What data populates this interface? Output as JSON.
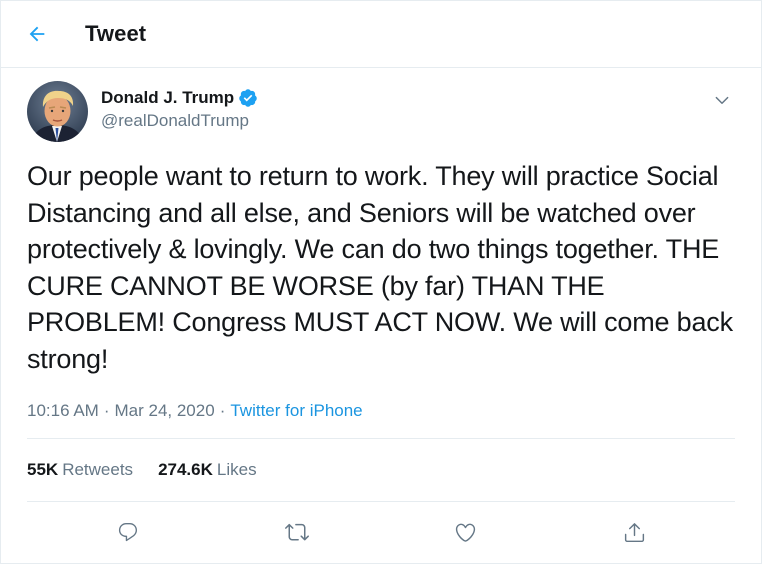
{
  "header": {
    "title": "Tweet",
    "back_icon": "arrow-left-icon"
  },
  "author": {
    "name": "Donald J. Trump",
    "handle": "@realDonaldTrump",
    "verified": true,
    "verified_icon": "verified-badge-icon"
  },
  "tweet": {
    "text": "Our people want to return to work. They will practice Social Distancing and all else, and Seniors will be watched over protectively & lovingly. We can do two things together. THE CURE CANNOT BE WORSE (by far) THAN THE PROBLEM! Congress MUST ACT NOW. We will come back strong!",
    "time": "10:16 AM",
    "separator": "·",
    "date": "Mar 24, 2020",
    "source": "Twitter for iPhone"
  },
  "stats": {
    "retweets_count": "55K",
    "retweets_label": "Retweets",
    "likes_count": "274.6K",
    "likes_label": "Likes"
  },
  "actions": [
    "reply-icon",
    "retweet-icon",
    "like-icon",
    "share-icon"
  ],
  "colors": {
    "accent": "#1da1f2",
    "link": "#1b95e0",
    "secondary_text": "#657786",
    "primary_text": "#14171a",
    "border": "#e6ecf0"
  }
}
